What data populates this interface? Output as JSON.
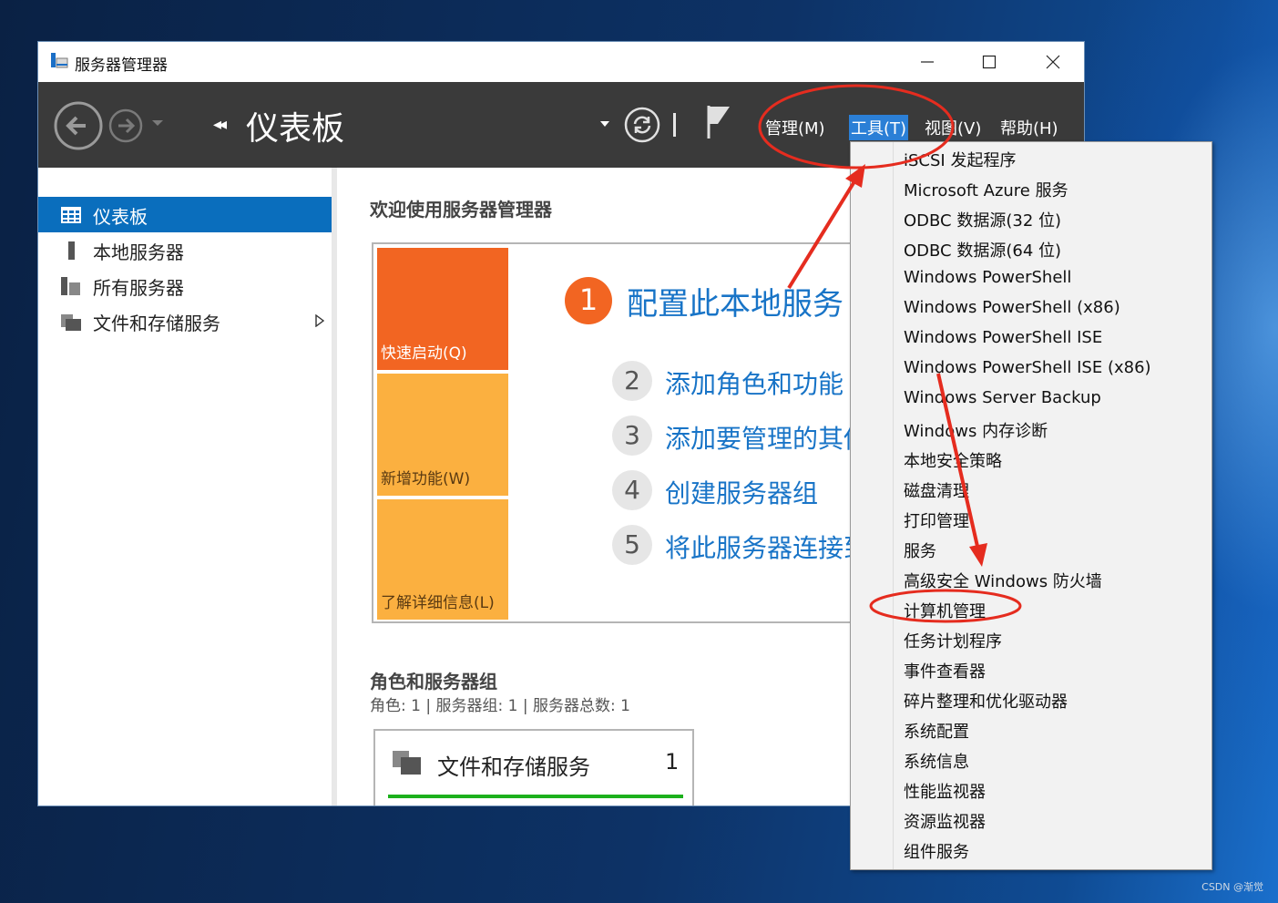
{
  "window": {
    "title": "服务器管理器"
  },
  "toolbar": {
    "breadcrumb_arrows": "◂◂",
    "page_title": "仪表板",
    "menus": {
      "manage": "管理(M)",
      "tools": "工具(T)",
      "view": "视图(V)",
      "help": "帮助(H)"
    }
  },
  "sidebar": {
    "items": [
      {
        "label": "仪表板",
        "icon": "dashboard-icon",
        "active": true
      },
      {
        "label": "本地服务器",
        "icon": "server-icon"
      },
      {
        "label": "所有服务器",
        "icon": "servers-icon"
      },
      {
        "label": "文件和存储服务",
        "icon": "storage-icon",
        "has_submenu": true
      }
    ]
  },
  "main": {
    "welcome": "欢迎使用服务器管理器",
    "tiles": [
      "快速启动(Q)",
      "新增功能(W)",
      "了解详细信息(L)"
    ],
    "steps": [
      {
        "num": "1",
        "text": "配置此本地服务"
      },
      {
        "num": "2",
        "text": "添加角色和功能"
      },
      {
        "num": "3",
        "text": "添加要管理的其他"
      },
      {
        "num": "4",
        "text": "创建服务器组"
      },
      {
        "num": "5",
        "text": "将此服务器连接到"
      }
    ],
    "roles_title": "角色和服务器组",
    "roles_subtitle": "角色: 1 | 服务器组: 1 | 服务器总数: 1",
    "role_card": {
      "title": "文件和存储服务",
      "count": "1",
      "status_color": "#1cb01c"
    }
  },
  "tools_menu": {
    "items": [
      "iSCSI 发起程序",
      "Microsoft Azure 服务",
      "ODBC 数据源(32 位)",
      "ODBC 数据源(64 位)",
      "Windows PowerShell",
      "Windows PowerShell (x86)",
      "Windows PowerShell ISE",
      "Windows PowerShell ISE (x86)",
      "Windows Server Backup",
      "Windows 内存诊断",
      "本地安全策略",
      "磁盘清理",
      "打印管理",
      "服务",
      "高级安全 Windows 防火墙",
      "计算机管理",
      "任务计划程序",
      "事件查看器",
      "碎片整理和优化驱动器",
      "系统配置",
      "系统信息",
      "性能监视器",
      "资源监视器",
      "组件服务"
    ],
    "highlighted": "计算机管理"
  },
  "colors": {
    "accent_blue": "#0a6ebd",
    "toolbar_dark": "#3a3a3a",
    "quick_start_orange": "#f26522",
    "tile_amber": "#fbb040",
    "annotation_red": "#e52c1f"
  },
  "watermark": "CSDN @渐觉"
}
